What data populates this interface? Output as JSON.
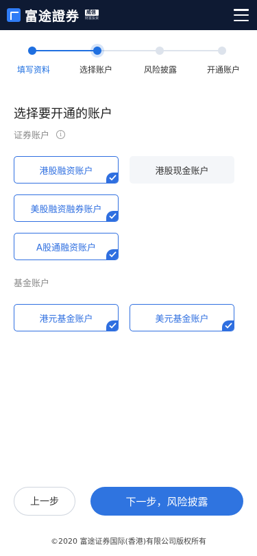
{
  "header": {
    "brand": "富途證券",
    "badge_top": "威信",
    "badge_bottom": "財富投資"
  },
  "steps": [
    {
      "label": "填写资料",
      "state": "done"
    },
    {
      "label": "选择账户",
      "state": "current"
    },
    {
      "label": "风险披露",
      "state": "todo"
    },
    {
      "label": "开通账户",
      "state": "todo"
    }
  ],
  "main": {
    "title": "选择要开通的账户",
    "securities_label": "证券账户",
    "info_glyph": "i",
    "fund_label": "基金账户",
    "securities_accounts": [
      {
        "label": "港股融资账户",
        "selected": true
      },
      {
        "label": "港股现金账户",
        "selected": false
      },
      {
        "label": "美股融资融券账户",
        "selected": true
      },
      {
        "label": "A股通融资账户",
        "selected": true
      }
    ],
    "fund_accounts": [
      {
        "label": "港元基金账户",
        "selected": true
      },
      {
        "label": "美元基金账户",
        "selected": true
      }
    ]
  },
  "actions": {
    "prev_label": "上一步",
    "next_label": "下一步，风险披露"
  },
  "footer": {
    "copyright": "©2020 富途证券国际(香港)有限公司版权所有"
  },
  "colors": {
    "header_bg": "#0e1a33",
    "accent": "#2f6fe0",
    "unselected_bg": "#f4f6f9"
  }
}
